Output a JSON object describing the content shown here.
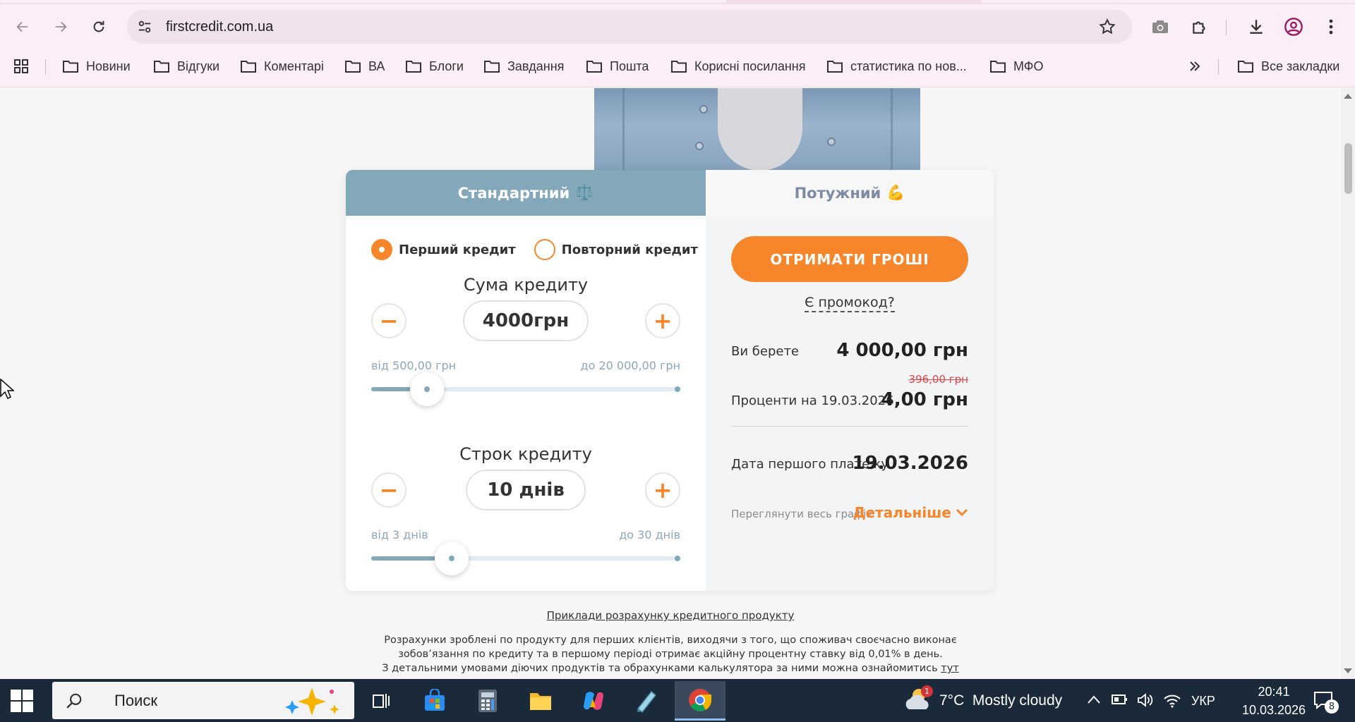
{
  "browser": {
    "url": "firstcredit.com.ua",
    "bookmarks": [
      "Новини",
      "Відгуки",
      "Коментарі",
      "ВА",
      "Блоги",
      "Завдання",
      "Пошта",
      "Корисні посилання",
      "статистика по нов...",
      "МФО"
    ],
    "all_bookmarks_label": "Все закладки"
  },
  "calculator": {
    "tabs": {
      "standard": "Стандартний",
      "standard_emoji": "⚖️",
      "powerful": "Потужний",
      "powerful_emoji": "💪"
    },
    "radio": {
      "first": "Перший кредит",
      "repeat": "Повторний кредит",
      "selected": "first"
    },
    "amount": {
      "title": "Сума кредиту",
      "value": "4000грн",
      "min_label": "від 500,00 грн",
      "max_label": "до 20 000,00 грн",
      "slider_fraction": 0.18
    },
    "term": {
      "title": "Строк кредиту",
      "value": "10 днів",
      "min_label": "від 3 днів",
      "max_label": "до 30 днів",
      "slider_fraction": 0.26
    },
    "minus_symbol": "−",
    "plus_symbol": "+",
    "summary": {
      "get_money_button": "ОТРИМАТИ ГРОШІ",
      "promo_link": "Є промокод?",
      "take_label": "Ви берете",
      "take_value": "4 000,00 грн",
      "old_interest": "396,00 грн",
      "interest_label": "Проценти на 19.03.2026",
      "interest_value": "4,00 грн",
      "first_payment_label": "Дата першого платежу",
      "first_payment_value": "19.03.2026",
      "schedule_label": "Переглянути весь графік",
      "details_link": "Детальніше"
    }
  },
  "footer": {
    "examples_link": "Приклади розрахунку кредитного продукту",
    "note_line1": "Розрахунки зроблені по продукту для перших клієнтів, виходячи з того, що споживач своєчасно виконає",
    "note_line2": "зобов’язання по кредиту та в першому періоді отримає акційну процентну ставку від 0,01% в день.",
    "note_line3": "З детальними умовами діючих продуктів та обрахунками калькулятора за ними можна ознайомитись",
    "note_link": "тут"
  },
  "taskbar": {
    "search_placeholder": "Поиск",
    "weather_badge": "1",
    "weather": "7°C  Mostly cloudy",
    "language": "УКР",
    "time": "20:41",
    "date": "10.03.2026",
    "notification_count": "8"
  },
  "colors": {
    "accent": "#f7852a",
    "tab_active": "#82a8ba",
    "chrome_bg": "#fbeef6",
    "taskbar_bg": "#1b2a3a"
  }
}
